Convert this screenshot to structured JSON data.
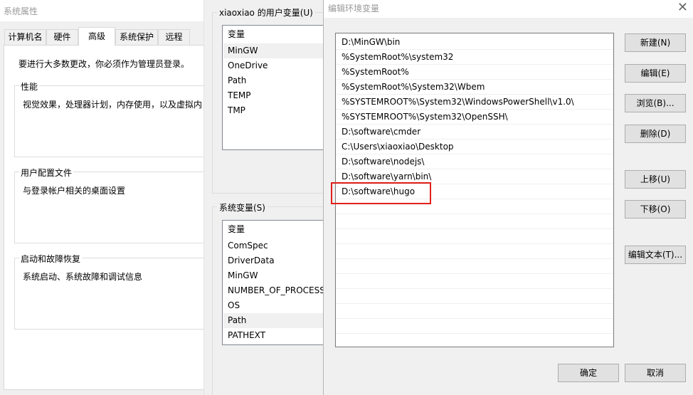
{
  "system_properties": {
    "title": "系统属性",
    "tabs": [
      "计算机名",
      "硬件",
      "高级",
      "系统保护",
      "远程"
    ],
    "active_tab": 2,
    "admin_notice": "要进行大多数更改，你必须作为管理员登录。",
    "groups": [
      {
        "label": "性能",
        "desc": "视觉效果，处理器计划，内存使用，以及虚拟内"
      },
      {
        "label": "用户配置文件",
        "desc": "与登录帐户相关的桌面设置"
      },
      {
        "label": "启动和故障恢复",
        "desc": "系统启动、系统故障和调试信息"
      }
    ]
  },
  "env_vars": {
    "user_section_label": "xiaoxiao 的用户变量(U)",
    "user_header": "变量",
    "user_vars": [
      "MinGW",
      "OneDrive",
      "Path",
      "TEMP",
      "TMP"
    ],
    "system_section_label": "系统变量(S)",
    "system_header": "变量",
    "system_vars": [
      "ComSpec",
      "DriverData",
      "MinGW",
      "NUMBER_OF_PROCESSORS",
      "OS",
      "Path",
      "PATHEXT"
    ]
  },
  "edit_dialog": {
    "title": "编辑环境变量",
    "close_glyph": "✕",
    "paths": [
      "D:\\MinGW\\bin",
      "%SystemRoot%\\system32",
      "%SystemRoot%",
      "%SystemRoot%\\System32\\Wbem",
      "%SYSTEMROOT%\\System32\\WindowsPowerShell\\v1.0\\",
      "%SYSTEMROOT%\\System32\\OpenSSH\\",
      "D:\\software\\cmder",
      "C:\\Users\\xiaoxiao\\Desktop",
      "D:\\software\\nodejs\\",
      "D:\\software\\yarn\\bin\\",
      "D:\\software\\hugo"
    ],
    "buttons": {
      "new": "新建(N)",
      "edit": "编辑(E)",
      "browse": "浏览(B)...",
      "delete": "删除(D)",
      "move_up": "上移(U)",
      "move_down": "下移(O)",
      "edit_text": "编辑文本(T)...",
      "ok": "确定",
      "cancel": "取消"
    },
    "highlight_color": "#e0201a"
  }
}
